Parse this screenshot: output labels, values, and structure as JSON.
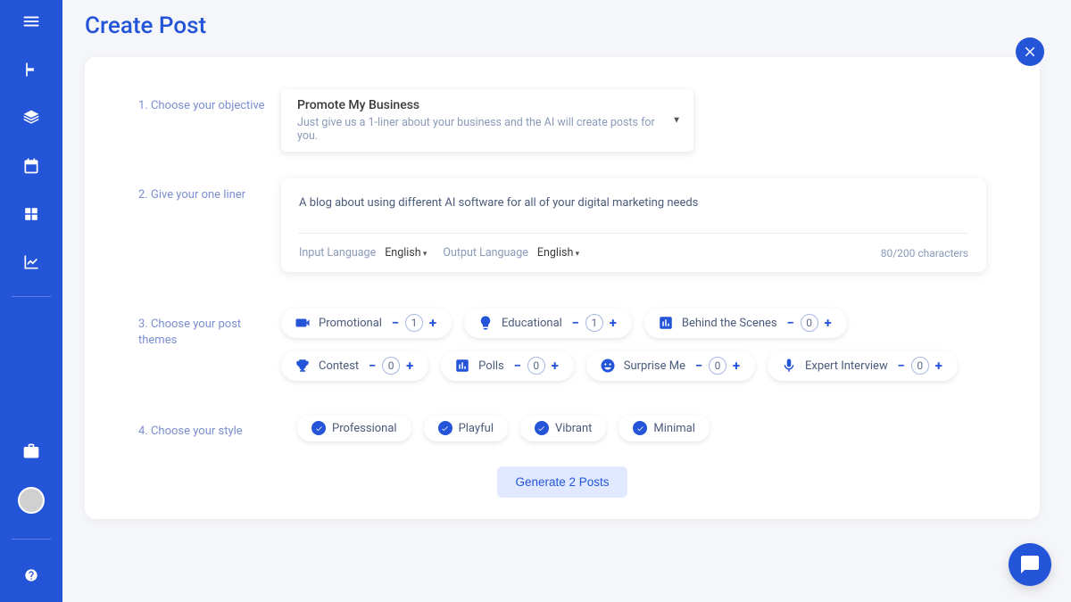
{
  "page_title": "Create Post",
  "step1": {
    "label": "1. Choose your objective",
    "title": "Promote My Business",
    "subtitle": "Just give us a 1-liner about your business and the AI will create posts for you."
  },
  "step2": {
    "label": "2. Give your one liner",
    "text": "A blog about using different AI software for all of your digital marketing needs",
    "input_lang_label": "Input Language",
    "input_lang": "English",
    "output_lang_label": "Output Language",
    "output_lang": "English",
    "char_count": "80/200 characters"
  },
  "step3": {
    "label": "3. Choose your post themes",
    "themes": [
      {
        "name": "Promotional",
        "count": "1"
      },
      {
        "name": "Educational",
        "count": "1"
      },
      {
        "name": "Behind the Scenes",
        "count": "0"
      },
      {
        "name": "Contest",
        "count": "0"
      },
      {
        "name": "Polls",
        "count": "0"
      },
      {
        "name": "Surprise Me",
        "count": "0"
      },
      {
        "name": "Expert Interview",
        "count": "0"
      }
    ]
  },
  "step4": {
    "label": "4. Choose your style",
    "styles": [
      "Professional",
      "Playful",
      "Vibrant",
      "Minimal"
    ]
  },
  "generate_btn": "Generate 2 Posts"
}
